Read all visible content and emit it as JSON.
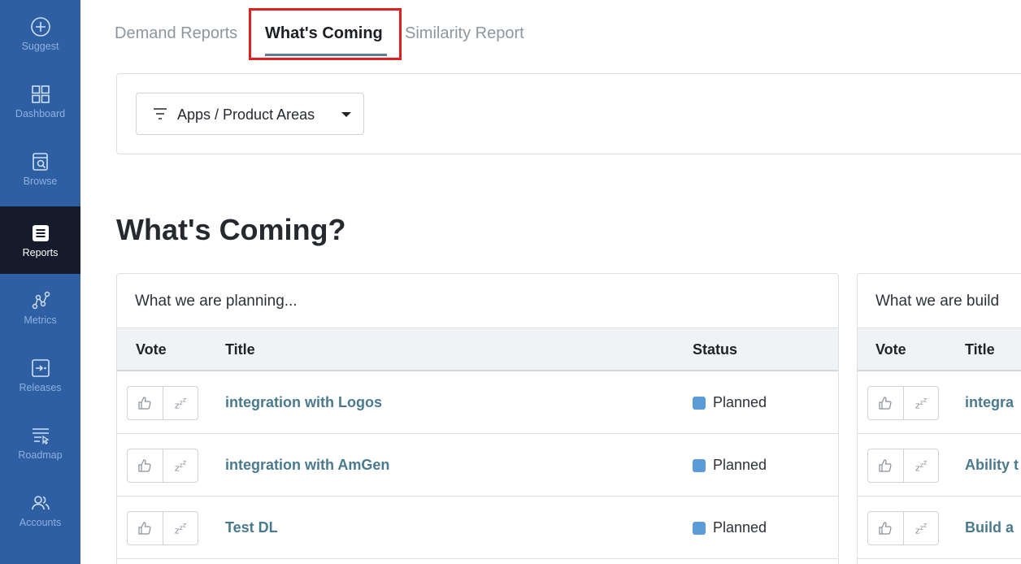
{
  "sidebar": {
    "items": [
      {
        "label": "Suggest",
        "icon": "plus-circle-icon"
      },
      {
        "label": "Dashboard",
        "icon": "grid-icon"
      },
      {
        "label": "Browse",
        "icon": "browse-icon"
      },
      {
        "label": "Reports",
        "icon": "reports-icon",
        "active": true
      },
      {
        "label": "Metrics",
        "icon": "metrics-icon"
      },
      {
        "label": "Releases",
        "icon": "releases-icon"
      },
      {
        "label": "Roadmap",
        "icon": "roadmap-icon"
      },
      {
        "label": "Accounts",
        "icon": "accounts-icon"
      }
    ]
  },
  "tabs": [
    {
      "label": "Demand Reports"
    },
    {
      "label": "What's Coming",
      "active": true
    },
    {
      "label": "Similarity Report"
    }
  ],
  "filter": {
    "label": "Apps / Product Areas"
  },
  "page_title": "What's Coming?",
  "planning": {
    "title": "What we are planning...",
    "columns": {
      "vote": "Vote",
      "title": "Title",
      "status": "Status"
    },
    "rows": [
      {
        "title": "integration with Logos",
        "status": "Planned"
      },
      {
        "title": "integration with AmGen",
        "status": "Planned"
      },
      {
        "title": "Test DL",
        "status": "Planned"
      }
    ]
  },
  "building": {
    "title": "What we are build",
    "columns": {
      "vote": "Vote",
      "title": "Title"
    },
    "rows": [
      {
        "title": "integra"
      },
      {
        "title": "Ability t"
      },
      {
        "title": "Build a"
      }
    ]
  },
  "colors": {
    "sidebar": "#2f5fa3",
    "sidebar_active": "#161b2c",
    "link": "#4a7a8e",
    "status_planned": "#5b9bd8",
    "highlight": "#e02020"
  }
}
